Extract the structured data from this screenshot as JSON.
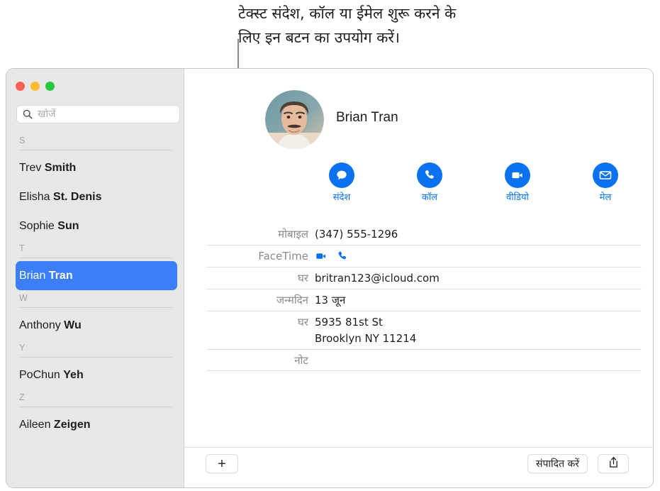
{
  "callout": {
    "text": "टेक्स्ट संदेश, कॉल या ईमेल शुरू करने के\nलिए इन बटन का उपयोग करें।"
  },
  "window": {
    "traffic_lights": [
      {
        "name": "close",
        "color": "#FF5F57"
      },
      {
        "name": "minimize",
        "color": "#FEBC2E"
      },
      {
        "name": "zoom",
        "color": "#28C840"
      }
    ]
  },
  "sidebar": {
    "search": {
      "placeholder": "खोजें",
      "value": "",
      "icon": "search-icon"
    },
    "sections": [
      {
        "letter": "S",
        "contacts": [
          {
            "first": "Trev ",
            "last": "Smith",
            "selected": false
          },
          {
            "first": "Elisha ",
            "last": "St. Denis",
            "selected": false
          },
          {
            "first": "Sophie ",
            "last": "Sun",
            "selected": false
          }
        ]
      },
      {
        "letter": "T",
        "contacts": [
          {
            "first": "Brian ",
            "last": "Tran",
            "selected": true
          }
        ]
      },
      {
        "letter": "W",
        "contacts": [
          {
            "first": "Anthony ",
            "last": "Wu",
            "selected": false
          }
        ]
      },
      {
        "letter": "Y",
        "contacts": [
          {
            "first": "PoChun ",
            "last": "Yeh",
            "selected": false
          }
        ]
      },
      {
        "letter": "Z",
        "contacts": [
          {
            "first": "Aileen ",
            "last": "Zeigen",
            "selected": false
          }
        ]
      }
    ]
  },
  "detail": {
    "name": "Brian Tran",
    "avatar": "contact-photo",
    "actions": [
      {
        "label": "संदेश",
        "icon": "message-bubble-icon"
      },
      {
        "label": "कॉल",
        "icon": "phone-icon"
      },
      {
        "label": "वीडियो",
        "icon": "video-camera-icon"
      },
      {
        "label": "मेल",
        "icon": "envelope-icon"
      }
    ],
    "accent_color": "#0A72F0",
    "fields": [
      {
        "label": "मोबाइल",
        "value": "(347) 555-1296",
        "type": "text"
      },
      {
        "label": "FaceTime",
        "value": "",
        "type": "icons",
        "icons": [
          "video-camera-icon",
          "phone-icon"
        ]
      },
      {
        "label": "घर",
        "value": "britran123@icloud.com",
        "type": "text"
      },
      {
        "label": "जन्मदिन",
        "value": "13 जून",
        "type": "text"
      },
      {
        "label": "घर",
        "value": "5935 81st St\nBrooklyn NY 11214",
        "type": "text"
      },
      {
        "label": "नोट",
        "value": "",
        "type": "text"
      }
    ]
  },
  "toolbar": {
    "add_label": "+",
    "edit_label": "संपादित करें",
    "share_icon": "share-icon"
  }
}
